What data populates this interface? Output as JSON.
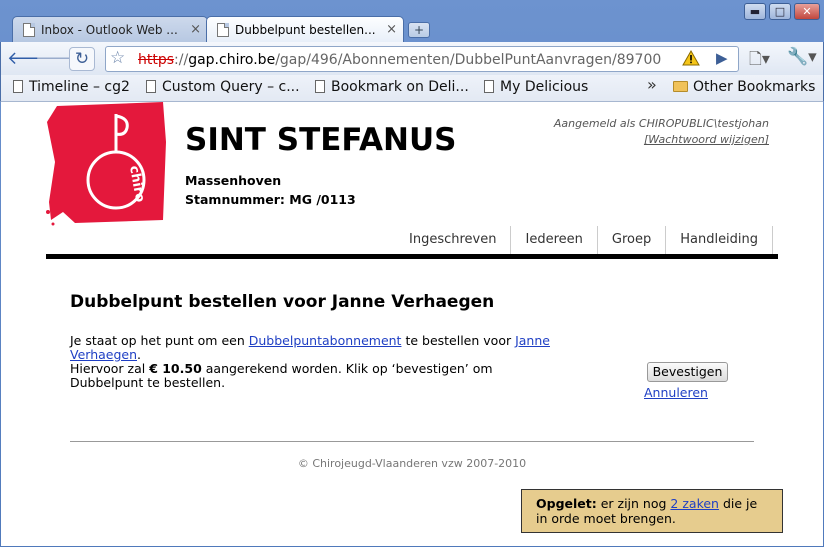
{
  "browser": {
    "tabs": [
      {
        "label": "Inbox - Outlook Web ...",
        "close": "×"
      },
      {
        "label": "Dubbelpunt bestellen...",
        "close": "×"
      }
    ],
    "new_tab": "+",
    "window_buttons": {
      "minimize": "▬",
      "maximize": "□",
      "close": "✕"
    },
    "url": {
      "scheme": "https",
      "sep": "://",
      "host": "gap.chiro.be",
      "path": "/gap/496/Abonnementen/DubbelPuntAanvragen/89700"
    },
    "bookmarks": [
      "Timeline – cg2",
      "Custom Query – c...",
      "Bookmark on Deli...",
      "My Delicious"
    ],
    "bookmarks_overflow": "»",
    "other_bookmarks": "Other Bookmarks"
  },
  "site": {
    "title": "SINT STEFANUS",
    "location": "Massenhoven",
    "stamnummer": "Stamnummer: MG /0113",
    "login_text": "Aangemeld als CHIROPUBLIC\\testjohan",
    "change_password": "[Wachtwoord wijzigen]",
    "nav": [
      "Ingeschreven",
      "Iedereen",
      "Groep",
      "Handleiding"
    ]
  },
  "main": {
    "heading": "Dubbelpunt bestellen voor Janne Verhaegen",
    "text_1": "Je staat op het punt om een ",
    "link_subscription": "Dubbelpuntabonnement",
    "text_2": " te bestellen voor ",
    "link_person": "Janne Verhaegen",
    "text_3": ".",
    "text_4": "Hiervoor zal ",
    "amount": "€ 10.50",
    "text_5": " aangerekend worden. Klik op ‘bevestigen’ om Dubbelpunt te bestellen.",
    "confirm_label": "Bevestigen",
    "cancel_label": "Annuleren"
  },
  "footer": "© Chirojeugd-Vlaanderen vzw 2007-2010",
  "notice": {
    "bold": "Opgelet:",
    "text_1": " er zijn nog ",
    "link": "2 zaken",
    "text_2": " die je in orde moet brengen."
  },
  "colors": {
    "logo_red": "#e4183c",
    "notice_bg": "#e6cc8e",
    "link": "#1f3fc4"
  }
}
